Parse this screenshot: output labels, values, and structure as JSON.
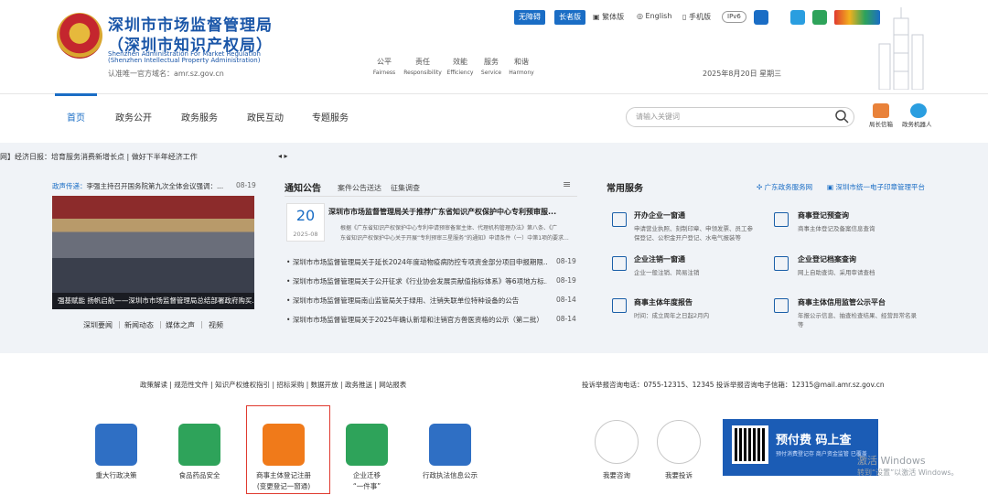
{
  "header": {
    "title_line1": "深圳市市场监督管理局",
    "title_line2": "（深圳市知识产权局）",
    "en_line1": "Shenzhen Administration For Market Regulation",
    "en_line2": "(Shenzhen Intellectual Property Administration)",
    "domain_note": "认准唯一官方域名：amr.sz.gov.cn",
    "accessibility_button": "无障碍",
    "elder_button": "长者版",
    "traditional": "繁体版",
    "english": "English",
    "mobile": "手机版",
    "ipv6": "IPv6",
    "values": [
      {
        "cn": "公平",
        "en": "Fairness"
      },
      {
        "cn": "责任",
        "en": "Responsibility"
      },
      {
        "cn": "效能",
        "en": "Efficiency"
      },
      {
        "cn": "服务",
        "en": "Service"
      },
      {
        "cn": "和谐",
        "en": "Harmony"
      }
    ],
    "date": "2025年8月20日 星期三"
  },
  "nav": {
    "items": [
      "首页",
      "政务公开",
      "政务服务",
      "政民互动",
      "专题服务"
    ],
    "search_placeholder": "请输入关键词",
    "right_items": [
      "局长信箱",
      "政务机器人"
    ]
  },
  "ticker": {
    "text": "网】经济日报：培育服务消费新增长点 | 做好下半年经济工作",
    "control": "◂ ▸"
  },
  "news": {
    "top_tag": "政声传递：",
    "top_title": "李强主持召开国务院第九次全体会议强调：...",
    "top_date": "08-19",
    "photo_caption": "强基赋能 扬帆启航——深圳市市场监督管理局总结部署政府购买...",
    "links": [
      "深圳要闻",
      "新闻动态",
      "媒体之声",
      "视频"
    ]
  },
  "notices": {
    "title": "通知公告",
    "tabs": [
      "案件公告送达",
      "征集调查"
    ],
    "more": "≡",
    "top_day": "20",
    "top_month": "2025-08",
    "top_title": "深圳市市场监督管理局关于推荐广东省知识产权保护中心专利预审服...",
    "top_sum1": "根据《广东省知识产权保护中心专利申请预审备案主体、代理机构管理办法》第八条、《广",
    "top_sum2": "东省知识产权保护中心关于开展“专利预审三星服务”的通知》申请条件（一）中第1项的要求...",
    "rows": [
      {
        "title": "深圳市市场监督管理局关于延长2024年度动物疫病防控专项资金部分项目申报期限...",
        "date": "08-19"
      },
      {
        "title": "深圳市市场监督管理局关于公开征求《行业协会发展贡献值指标体系》等6项地方标...",
        "date": "08-19"
      },
      {
        "title": "深圳市市场监督管理局南山监管局关于绿用、注销失联单位特种设备的公告",
        "date": "08-14"
      },
      {
        "title": "深圳市市场监督管理局关于2025年确认新增和注销官方兽医资格的公示（第二批）",
        "date": "08-14"
      }
    ]
  },
  "services": {
    "title": "常用服务",
    "link1": "广东政务服务网",
    "link2": "深圳市统一电子印章管理平台",
    "items": [
      {
        "name": "开办企业一窗通",
        "d1": "申请营业执照、刻制印章、申领发票、员工参",
        "d2": "保登记、公积金开户登记、水电气报装等"
      },
      {
        "name": "商事登记预查询",
        "d1": "商事主体登记及备案信息查询",
        "d2": ""
      },
      {
        "name": "企业注销一窗通",
        "d1": "企业一般注销、简易注销",
        "d2": ""
      },
      {
        "name": "企业登记档案查询",
        "d1": "网上自助查询、采用审请查档",
        "d2": ""
      },
      {
        "name": "商事主体年度报告",
        "d1": "时间：成立周年之日起2月内",
        "d2": ""
      },
      {
        "name": "商事主体信用监管公示平台",
        "d1": "年报公示信息、抽查检查结果、经营异常名录",
        "d2": "等"
      }
    ]
  },
  "footer": {
    "links": "政策解读 | 规范性文件 | 知识产权维权指引 | 招标采购 | 数据开放 | 政务推送 | 网站报表",
    "contact": "投诉举报咨询电话：0755-12315、12345    投诉举报咨询电子信箱：12315@mail.amr.sz.gov.cn",
    "apps": [
      {
        "label": "重大行政决策",
        "label2": "",
        "color": "#2f6fc4"
      },
      {
        "label": "食品药品安全",
        "label2": "",
        "color": "#2ea35a"
      },
      {
        "label": "商事主体登记注册",
        "label2": "(变更登记一窗通)",
        "color": "#f07a1a"
      },
      {
        "label": "企业迁移",
        "label2": "“一件事”",
        "color": "#2ea35a"
      },
      {
        "label": "行政执法信息公示",
        "label2": "",
        "color": "#2f6fc4"
      }
    ],
    "circles": [
      "我要咨询",
      "我要投诉"
    ],
    "banner_title": "预付费  码上查",
    "banner_sub": "预付消费登记存  商户资金监管 已覆盖",
    "watermark1": "激活 Windows",
    "watermark2": "转到“设置”以激活 Windows。"
  }
}
